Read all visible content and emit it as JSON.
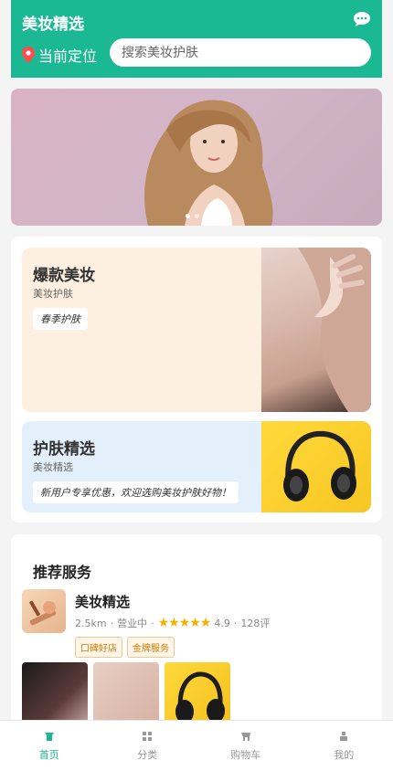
{
  "header": {
    "title": "美妆精选",
    "location_label": "当前定位",
    "search_placeholder": "搜索美妆护肤",
    "accent": "#1bb993"
  },
  "banner": {
    "dots": 3,
    "active_dot": 0
  },
  "promos": [
    {
      "title": "爆款美妆",
      "subtitle": "美妆护肤",
      "tag": "春季护肤",
      "bg": "#fdf0e0"
    },
    {
      "title": "护肤精选",
      "subtitle": "美妆精选",
      "tag": "新用户专享优惠，欢迎选购美妆护肤好物！",
      "bg": "#e3f0fb"
    }
  ],
  "recommend": {
    "section_title": "推荐服务",
    "shop": {
      "name": "美妆精选",
      "distance": "2.5km",
      "status": "营业中",
      "stars": "★★★★★",
      "rating": "4.9",
      "reviews": "128评",
      "badges": [
        "口碑好店",
        "金牌服务"
      ]
    }
  },
  "tabbar": {
    "items": [
      {
        "label": "首页",
        "icon": "home-icon",
        "active": true
      },
      {
        "label": "分类",
        "icon": "grid-icon",
        "active": false
      },
      {
        "label": "购物车",
        "icon": "cart-icon",
        "active": false
      },
      {
        "label": "我的",
        "icon": "user-icon",
        "active": false
      }
    ]
  }
}
